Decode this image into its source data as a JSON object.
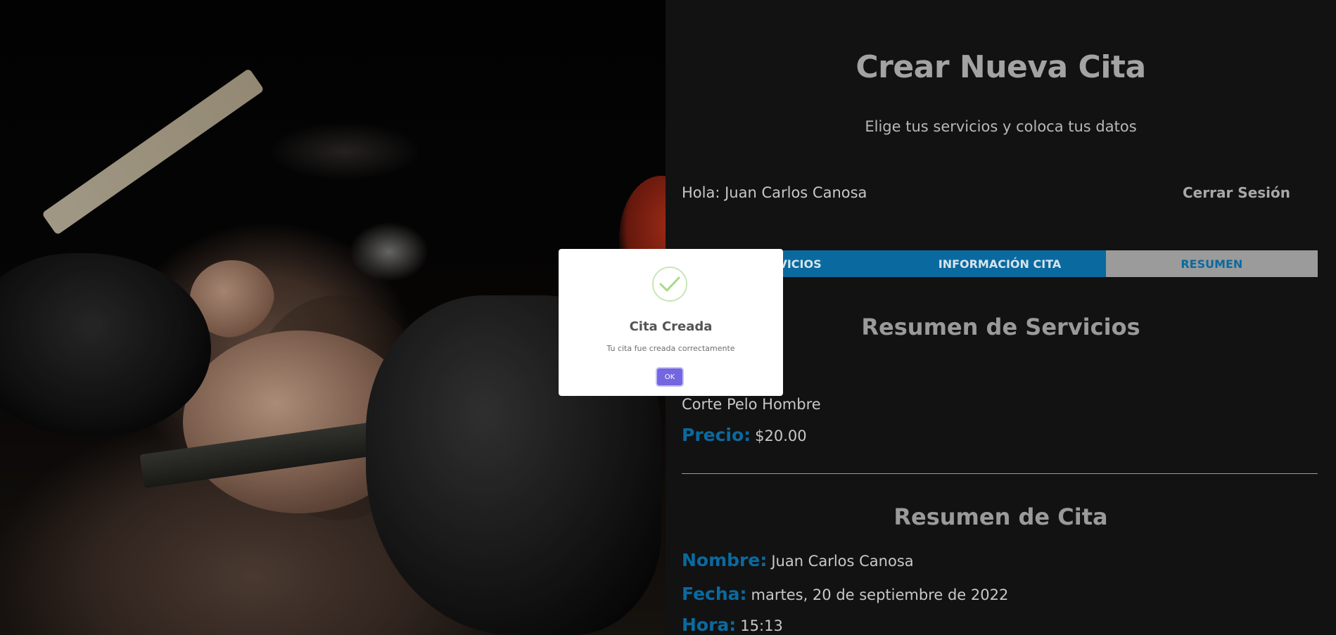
{
  "page": {
    "title": "Crear Nueva Cita",
    "subtitle": "Elige tus servicios y coloca tus datos"
  },
  "user_bar": {
    "greeting": "Hola: Juan Carlos Canosa",
    "logout_label": "Cerrar Sesión"
  },
  "tabs": [
    {
      "label": "SERVICIOS",
      "visible_text": "VICIOS",
      "active": false
    },
    {
      "label": "INFORMACIÓN CITA",
      "active": false
    },
    {
      "label": "RESUMEN",
      "active": true
    }
  ],
  "services_summary": {
    "title": "Resumen de Servicios",
    "service_name": "Corte Pelo Hombre",
    "price_label": "Precio:",
    "price_value": "$20.00"
  },
  "appointment_summary": {
    "title": "Resumen de Cita",
    "name_label": "Nombre:",
    "name_value": "Juan Carlos Canosa",
    "date_label": "Fecha:",
    "date_value": "martes, 20 de septiembre de 2022",
    "time_label": "Hora:",
    "time_value": "15:13"
  },
  "modal": {
    "icon": "success-check-icon",
    "title": "Cita Creada",
    "message": "Tu cita fue creada correctamente",
    "ok_label": "OK"
  },
  "colors": {
    "accent": "#0a6a9f",
    "panel_bg": "#121212",
    "modal_button": "#7366e0",
    "success": "#a5dc86"
  }
}
